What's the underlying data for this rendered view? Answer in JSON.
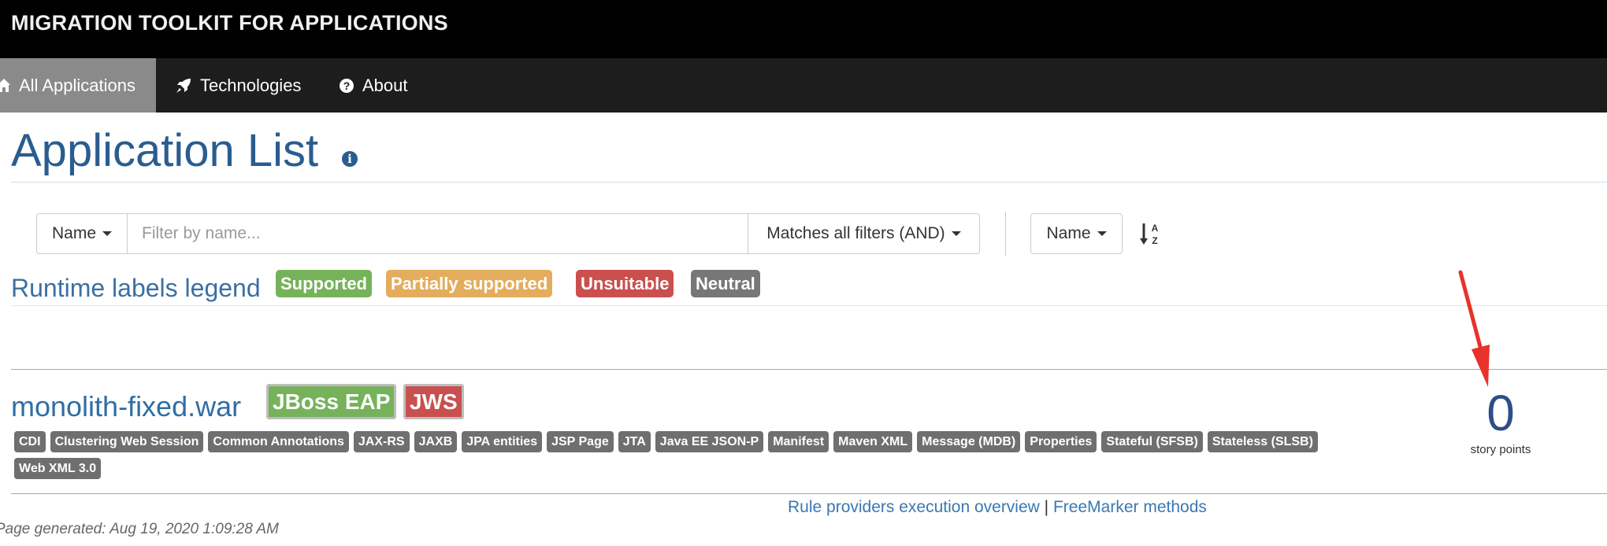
{
  "header": {
    "brand": "MIGRATION TOOLKIT FOR APPLICATIONS"
  },
  "nav": {
    "items": [
      {
        "label": "All Applications",
        "icon": "home-icon",
        "active": true
      },
      {
        "label": "Technologies",
        "icon": "rocket-icon",
        "active": false
      },
      {
        "label": "About",
        "icon": "question-circle-icon",
        "active": false
      }
    ]
  },
  "page": {
    "title": "Application List",
    "title_icon": "info-circle-icon"
  },
  "toolbar": {
    "filter_field": "Name",
    "filter_placeholder": "Filter by name...",
    "filter_value": "",
    "match_mode": "Matches all filters (AND)",
    "sort_field": "Name",
    "sort_icon": "sort-alpha-asc-icon"
  },
  "legend": {
    "label": "Runtime labels legend",
    "badges": [
      {
        "label": "Supported",
        "color": "#76b25a"
      },
      {
        "label": "Partially supported",
        "color": "#e3ad5d"
      },
      {
        "label": "Unsuitable",
        "color": "#c9504e"
      },
      {
        "label": "Neutral",
        "color": "#777777"
      }
    ]
  },
  "application": {
    "name": "monolith-fixed.war",
    "runtimes": [
      {
        "label": "JBoss EAP",
        "color": "#76b25a"
      },
      {
        "label": "JWS",
        "color": "#c9504e"
      }
    ],
    "tags": [
      "CDI",
      "Clustering Web Session",
      "Common Annotations",
      "JAX-RS",
      "JAXB",
      "JPA entities",
      "JSP Page",
      "JTA",
      "Java EE JSON-P",
      "Manifest",
      "Maven XML",
      "Message (MDB)",
      "Properties",
      "Stateful (SFSB)",
      "Stateless (SLSB)",
      "Web XML 3.0"
    ],
    "story_points": "0",
    "story_points_label": "story points"
  },
  "annotation": {
    "arrow_color": "#e8322b"
  },
  "footer": {
    "link1": "Rule providers execution overview",
    "separator": "|",
    "link2": "FreeMarker methods",
    "generated": "Page generated: Aug 19, 2020 1:09:28 AM"
  }
}
